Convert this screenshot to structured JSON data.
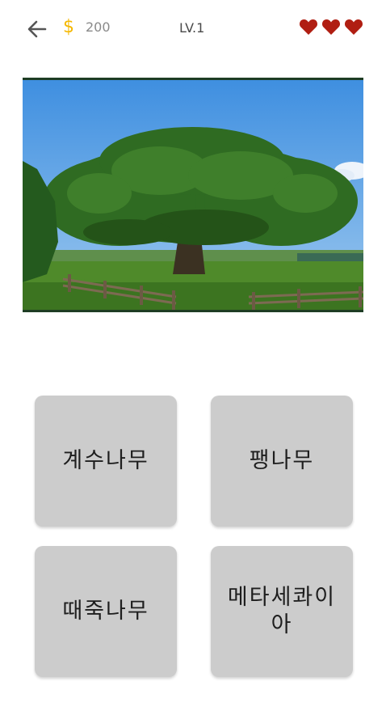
{
  "header": {
    "back_icon": "arrow-left-icon",
    "coin_icon": "dollar-icon",
    "coin_symbol": "$",
    "coins": "200",
    "level": "LV.1",
    "lives": 3,
    "heart_icon": "heart-icon",
    "heart_color": "#b01e12"
  },
  "quiz": {
    "image_subject": "large green tree in a field with wooden fence",
    "answers": [
      {
        "label": "계수나무"
      },
      {
        "label": "팽나무"
      },
      {
        "label": "때죽나무"
      },
      {
        "label": "메타세콰이아"
      }
    ]
  },
  "colors": {
    "answer_bg": "#cccccc",
    "coin": "#f5b800",
    "photo_border": "#1e3d24"
  }
}
